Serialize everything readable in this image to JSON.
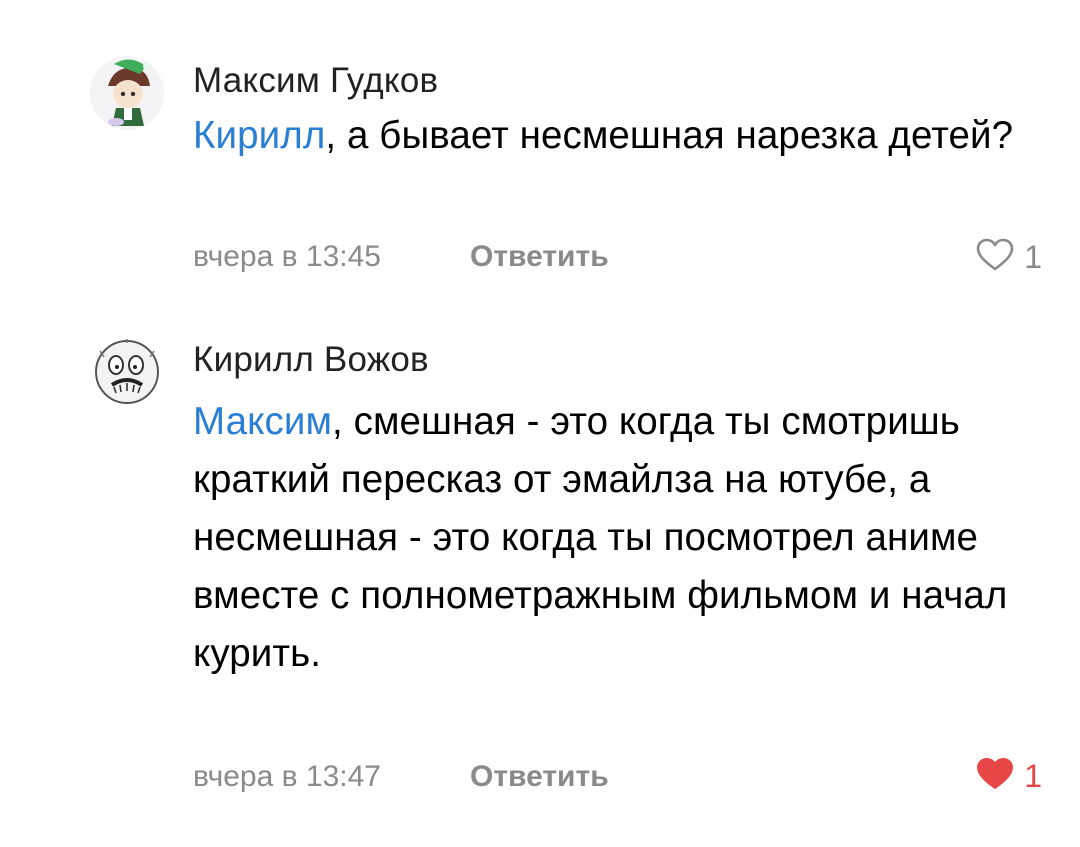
{
  "comments": [
    {
      "author": "Максим Гудков",
      "mention": "Кирилл",
      "text": ", а бывает несмешная нарезка детей?",
      "time": "вчера в 13:45",
      "reply_label": "Ответить",
      "likes": "1",
      "liked": false
    },
    {
      "author": "Кирилл Вожов",
      "mention": "Максим",
      "text": ", смешная - это когда ты смотришь краткий пересказ от эмайлза на ютубе, а несмешная - это когда ты посмотрел аниме вместе с полнометражным фильмом и начал курить.",
      "time": "вчера в 13:47",
      "reply_label": "Ответить",
      "likes": "1",
      "liked": true
    }
  ],
  "colors": {
    "mention": "#2a7fd4",
    "meta": "#8a8a8a",
    "liked_heart": "#e64646"
  },
  "icons": {
    "like_outline": "heart-outline-icon",
    "like_filled": "heart-filled-icon"
  }
}
